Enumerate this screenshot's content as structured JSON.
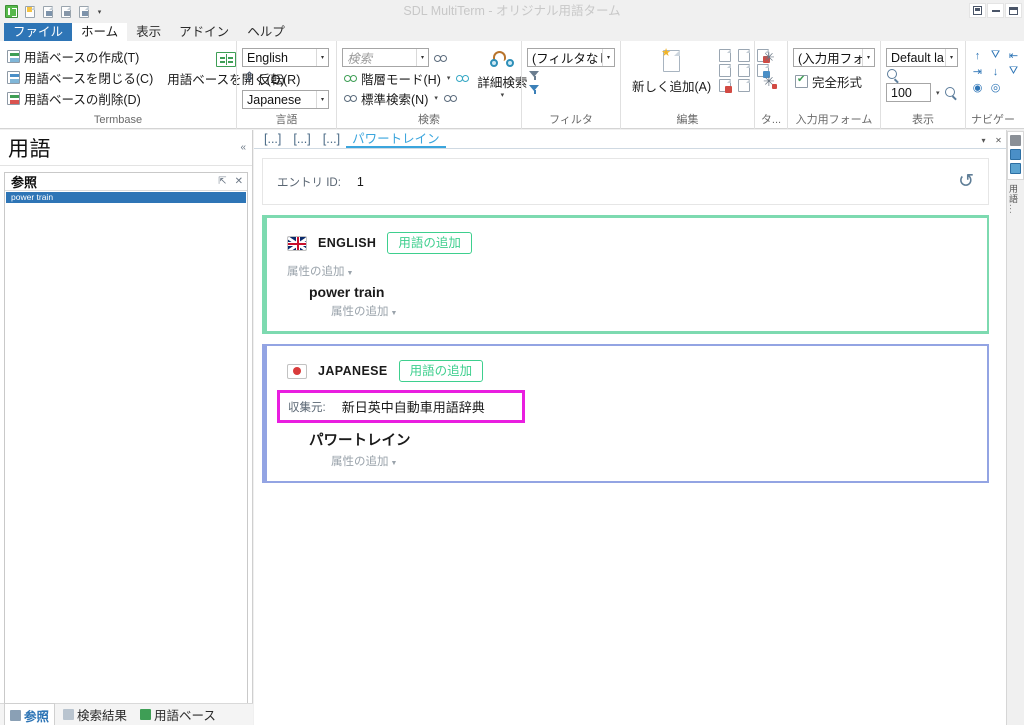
{
  "window": {
    "title": "SDL MultiTerm - オリジナル用語ターム",
    "quick_access": [
      {
        "name": "app-logo",
        "icon": "multiterm-logo-icon"
      },
      {
        "name": "new",
        "icon": "new-document-icon"
      },
      {
        "name": "open",
        "icon": "open-document-icon"
      },
      {
        "name": "save",
        "icon": "save-icon"
      },
      {
        "name": "save-as",
        "icon": "save-as-icon"
      },
      {
        "name": "customize",
        "icon": "chevron-down-icon"
      }
    ],
    "controls": [
      {
        "name": "ribbon-display-options",
        "icon": "ribbon-options-icon"
      },
      {
        "name": "minimize",
        "icon": "minimize-icon"
      },
      {
        "name": "restore",
        "icon": "restore-icon"
      }
    ]
  },
  "ribbon": {
    "tabs": [
      {
        "label": "ファイル",
        "style": "file"
      },
      {
        "label": "ホーム",
        "style": "active"
      },
      {
        "label": "表示",
        "style": "normal"
      },
      {
        "label": "アドイン",
        "style": "normal"
      },
      {
        "label": "ヘルプ",
        "style": "normal"
      }
    ],
    "groups": {
      "termbase": {
        "title": "Termbase",
        "create": "用語ベースの作成(T)",
        "close": "用語ベースを閉じる(C)",
        "delete": "用語ベースの削除(D)",
        "open": "用語ベースを開く(O)"
      },
      "language": {
        "title": "言語",
        "source_value": "English",
        "swap": "反転(R)",
        "target_value": "Japanese"
      },
      "search": {
        "title": "検索",
        "search_placeholder": "検索",
        "hierarchy_mode": "階層モード(H)",
        "standard_search": "標準検索(N)",
        "advanced_search": "詳細検索"
      },
      "filter": {
        "title": "フィルタ",
        "filter_value": "(フィルタなし)"
      },
      "edit": {
        "title": "編集",
        "add_new": "新しく追加(A)"
      },
      "ta": {
        "title": "タ..."
      },
      "input_form": {
        "title": "入力用フォーム",
        "form_value": "(入力用フォ",
        "full_form": "完全形式"
      },
      "display": {
        "title": "表示",
        "layout_value": "Default la",
        "zoom_value": "100"
      },
      "navigation": {
        "title": "ナビゲー"
      }
    }
  },
  "left_panel": {
    "title": "用語",
    "subpanel_title": "参照",
    "selected_item": "power train",
    "tabs": [
      {
        "label": "参照",
        "icon": "reference-icon",
        "active": true
      },
      {
        "label": "検索結果",
        "icon": "search-results-icon",
        "active": false
      },
      {
        "label": "用語ベース",
        "icon": "termbase-icon",
        "active": false
      }
    ]
  },
  "main": {
    "document_tabs": [
      {
        "label": "[...]",
        "active": false
      },
      {
        "label": "[...]",
        "active": false
      },
      {
        "label": "[...]",
        "active": false
      },
      {
        "label": "パワートレイン",
        "active": true
      }
    ],
    "entry": {
      "id_label": "エントリ ID:",
      "id_value": "1",
      "history_icon": "history-revert-icon"
    },
    "languages": [
      {
        "name": "ENGLISH",
        "flag": "uk-flag-icon",
        "add_term_label": "用語の追加",
        "add_attribute_label": "属性の追加",
        "terms": [
          {
            "text": "power train",
            "add_attribute_label": "属性の追加"
          }
        ],
        "accent_color": "#7ddab0"
      },
      {
        "name": "JAPANESE",
        "flag": "japan-flag-icon",
        "add_term_label": "用語の追加",
        "add_attribute_label": "属性の追加",
        "source_field": {
          "label": "収集元:",
          "value": "新日英中自動車用語辞典",
          "highlight_color": "#e91ee0"
        },
        "terms": [
          {
            "text": "パワートレイン",
            "add_attribute_label": "属性の追加"
          }
        ],
        "accent_color": "#93a4e3"
      }
    ]
  },
  "right_dock": {
    "label": "用語..."
  }
}
